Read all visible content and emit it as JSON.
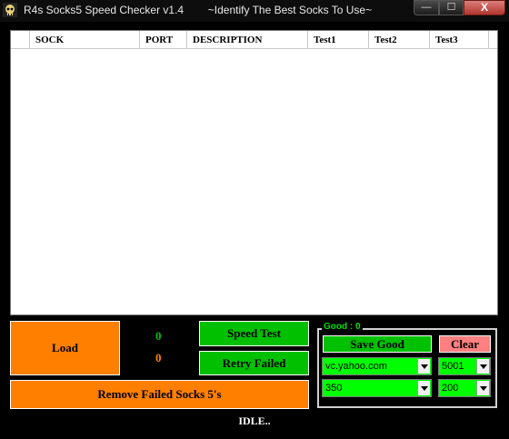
{
  "window": {
    "title": "R4s Socks5 Speed Checker v1.4        ~Identify The Best Socks To Use~",
    "controls": {
      "minimize": "—",
      "maximize": "☐",
      "close": "X"
    }
  },
  "list": {
    "columns": [
      "",
      "SOCK",
      "PORT",
      "DESCRIPTION",
      "Test1",
      "Test2",
      "Test3"
    ]
  },
  "buttons": {
    "load": "Load",
    "speed_test": "Speed Test",
    "retry_failed": "Retry Failed",
    "remove_failed": "Remove Failed Socks 5's",
    "save_good": "Save Good",
    "clear": "Clear"
  },
  "counters": {
    "green": "0",
    "orange": "0"
  },
  "good_group": {
    "label": "Good : 0"
  },
  "combos": {
    "host": "vc.yahoo.com",
    "port": "5001",
    "size": "350",
    "count": "200"
  },
  "status": "IDLE..",
  "colors": {
    "accent_orange": "#ff7f00",
    "accent_green": "#00c000",
    "combo_green": "#00ff00",
    "clear_pink": "#ff8080"
  }
}
